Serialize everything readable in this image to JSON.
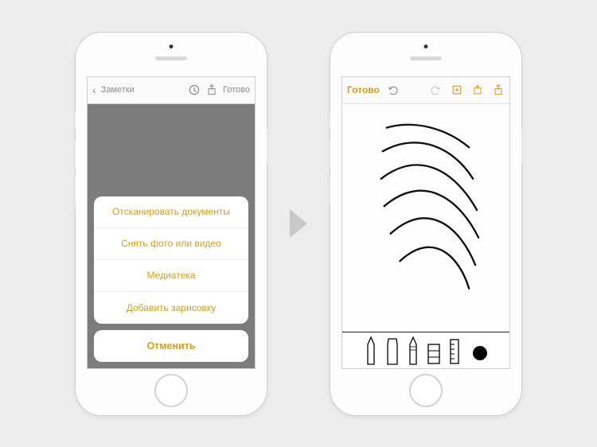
{
  "leftPhone": {
    "topbar": {
      "back_label": "Заметки",
      "done_label": "Готово"
    },
    "actionSheet": {
      "items": [
        {
          "label": "Отсканировать документы"
        },
        {
          "label": "Снять фото или видео"
        },
        {
          "label": "Медиатека"
        },
        {
          "label": "Добавить зарисовку"
        }
      ],
      "cancel_label": "Отменить"
    }
  },
  "rightPhone": {
    "topbar": {
      "done_label": "Готово"
    },
    "toolbar": {
      "tools": [
        "pen",
        "marker",
        "pencil",
        "eraser",
        "ruler",
        "color"
      ]
    }
  },
  "colors": {
    "accent": "#d4a017"
  }
}
